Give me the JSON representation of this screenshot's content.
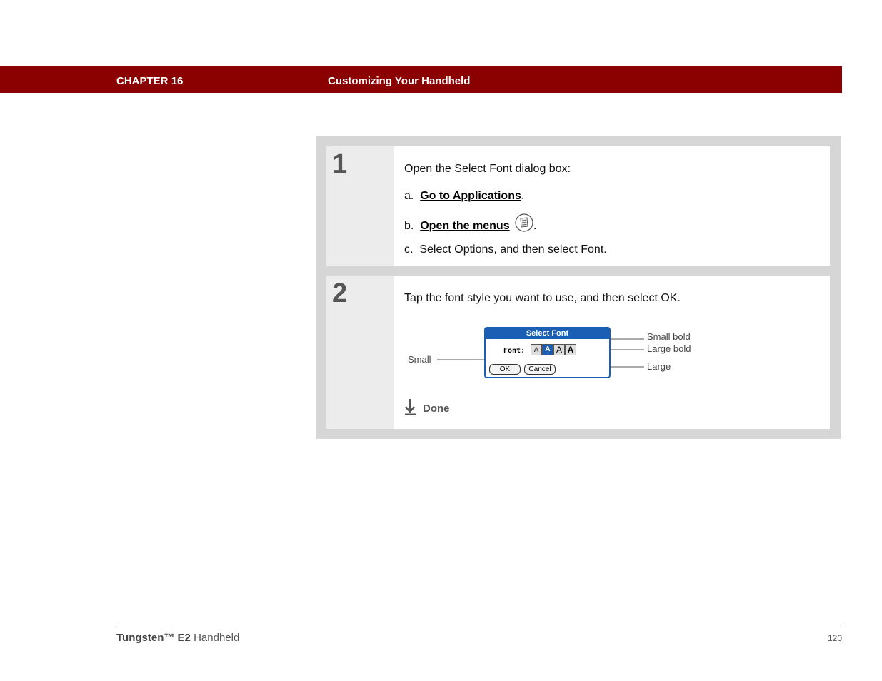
{
  "header": {
    "chapter": "CHAPTER 16",
    "title": "Customizing Your Handheld",
    "bg_color": "#8b0000"
  },
  "step1": {
    "number": "1",
    "intro": "Open the Select Font dialog box:",
    "items": [
      {
        "prefix": "a.",
        "link": "Go to Applications",
        "suffix": "."
      },
      {
        "prefix": "b.",
        "link": "Open the menus",
        "suffix": ".",
        "icon": "menu-icon"
      },
      {
        "prefix": "c.",
        "text": "Select Options, and then select Font."
      }
    ]
  },
  "step2": {
    "number": "2",
    "intro": "Tap the font style you want to use, and then select OK.",
    "dialog": {
      "title": "Select Font",
      "font_label": "Font:",
      "font_buttons": [
        "A",
        "A",
        "A",
        "A"
      ],
      "ok_label": "OK",
      "cancel_label": "Cancel",
      "accent_color": "#1a5fb4"
    },
    "callouts": {
      "small": "Small",
      "small_bold": "Small bold",
      "large_bold": "Large bold",
      "large": "Large"
    },
    "done_label": "Done",
    "done_icon": "arrow-down-icon"
  },
  "footer": {
    "product_brand": "Tungsten™ E2",
    "product_suffix": "Handheld",
    "page_number": "120"
  }
}
